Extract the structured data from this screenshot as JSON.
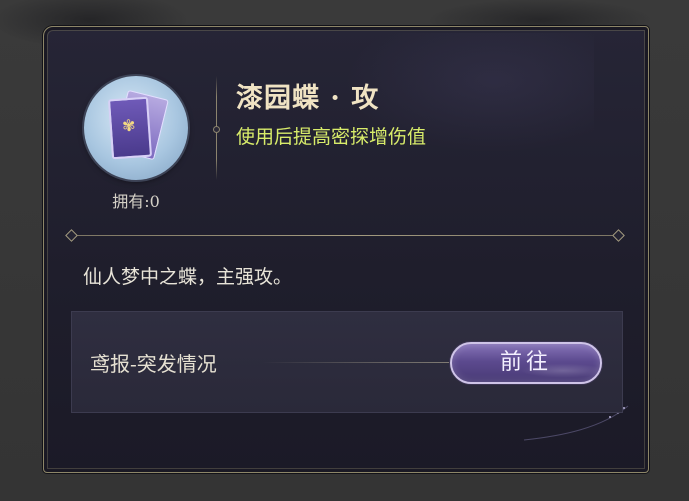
{
  "item": {
    "name": "漆园蝶 · 攻",
    "effect": "使用后提高密探增伤值",
    "owned": "拥有:0",
    "flavor": "仙人梦中之蝶，主强攻。"
  },
  "source": {
    "label": "鸢报-突发情况",
    "go_button": "前往"
  },
  "icons": {
    "item": "butterfly-card-icon",
    "emblem": "butterfly-emblem-icon"
  },
  "colors": {
    "title": "#f0e3c3",
    "effect": "#d8ec6a",
    "panel_border": "#8d8668",
    "button": "#5c4a8f"
  }
}
